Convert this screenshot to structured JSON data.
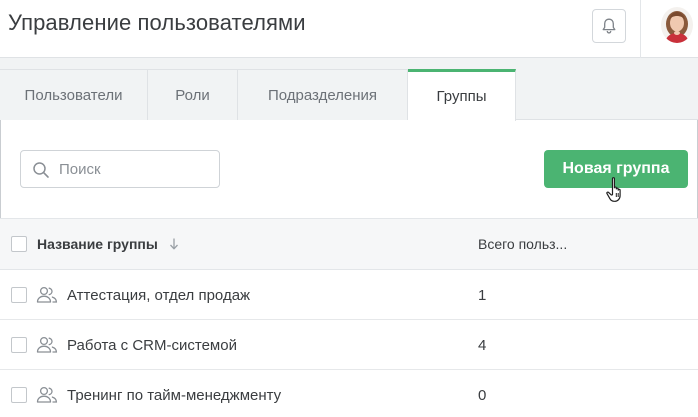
{
  "header": {
    "title": "Управление пользователями",
    "notifications_icon": "bell-icon",
    "avatar_icon": "user-avatar"
  },
  "tabs": [
    {
      "label": "Пользователи",
      "active": false
    },
    {
      "label": "Роли",
      "active": false
    },
    {
      "label": "Подразделения",
      "active": false
    },
    {
      "label": "Группы",
      "active": true
    }
  ],
  "toolbar": {
    "search_placeholder": "Поиск",
    "search_value": "",
    "new_group_label": "Новая группа"
  },
  "table": {
    "columns": [
      "Название группы",
      "Всего польз..."
    ],
    "sort_icon": "arrow-down-icon",
    "rows": [
      {
        "name": "Аттестация, отдел продаж",
        "total": "1"
      },
      {
        "name": "Работа с CRM-системой",
        "total": "4"
      },
      {
        "name": "Тренинг по тайм-менеджменту",
        "total": "0"
      }
    ]
  },
  "colors": {
    "accent": "#4bb472",
    "tab_bar_bg": "#f1f3f4",
    "header_row_bg": "#f6f7f8"
  }
}
